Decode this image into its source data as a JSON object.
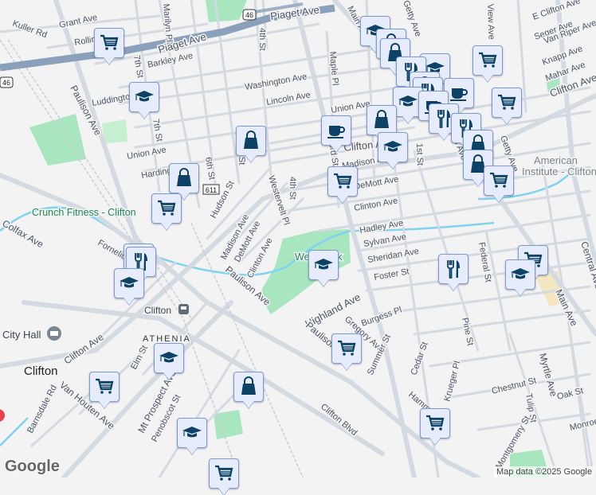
{
  "colors": {
    "marker_icon": "#0b4266",
    "marker_bg": "#e6ecfb",
    "park": "#a8e6bf",
    "water": "#7fd3f0",
    "highway": "#8aa0bb"
  },
  "labels": [
    "Grant Ave",
    "Kuller Rd",
    "Rollin",
    "Piaget Ave",
    "Piaget Ave",
    "Barkley Ave",
    "Washington Ave",
    "Lincoln Ave",
    "Luddington",
    "Union Ave",
    "Union Ave",
    "Harding",
    "Hudson St",
    "Madison Ave",
    "DeMott Ave",
    "Clinton Ave",
    "Westervelt Pl",
    "4th St",
    "4th St",
    "6th St",
    "7th St",
    "7th St",
    "Paulison Ave",
    "Marilyn Pl",
    "Maple Pl",
    "Main Ave",
    "Getty Ave",
    "View Ave",
    "E Clifton Ave",
    "Seger Ave",
    "Van Riper Ave",
    "Knapp Ave",
    "Mahar Ave",
    "Clifton Ave",
    "Clifton Ave",
    "Madison Ave",
    "DeMott Ave",
    "Clinton Ave",
    "Hadley Ave",
    "Sylvan Ave",
    "Sheridan Ave",
    "Foster St",
    "Highland Ave",
    "Burgess Pl",
    "Gregory Ave",
    "Summer St",
    "Cedar St",
    "Krueger Pl",
    "Pine St",
    "Federal St",
    "1st St",
    "3rd St",
    "Main Ave",
    "Getty Ave",
    "Main Ave",
    "Central Ave",
    "Myrtle Ave",
    "Tulip St",
    "Chestnut St",
    "Oak St",
    "Monroe",
    "Montgomery St",
    "Paulison Ave",
    "Paulison Ave",
    "Colfax Ave",
    "Fornelius",
    "Clifton Ave",
    "Elm St",
    "Van Houten Ave",
    "Barnsdale Rd",
    "Mt Prospect Ave",
    "Penobscot St",
    "Clifton Blvd",
    "St",
    "Hamm"
  ],
  "shields": {
    "us46": "46",
    "cr611": "611"
  },
  "places": {
    "gym": "Crunch Fitness - Clifton",
    "station": "Clifton",
    "city_hall": "City Hall",
    "neighborhood": "ATHENIA",
    "city": "Clifton",
    "park": "Westbrook",
    "institute_1": "American",
    "institute_2": "Institute - Clifton"
  },
  "icons": {
    "cart": "shopping-cart-icon",
    "school": "graduation-cap-icon",
    "bag": "shopping-bag-icon",
    "food": "fork-knife-icon",
    "cafe": "coffee-cup-icon",
    "train": "train-icon",
    "landmark": "landmark-icon"
  },
  "footer": {
    "logo": "Google",
    "attribution": "Map data ©2025 Google"
  }
}
